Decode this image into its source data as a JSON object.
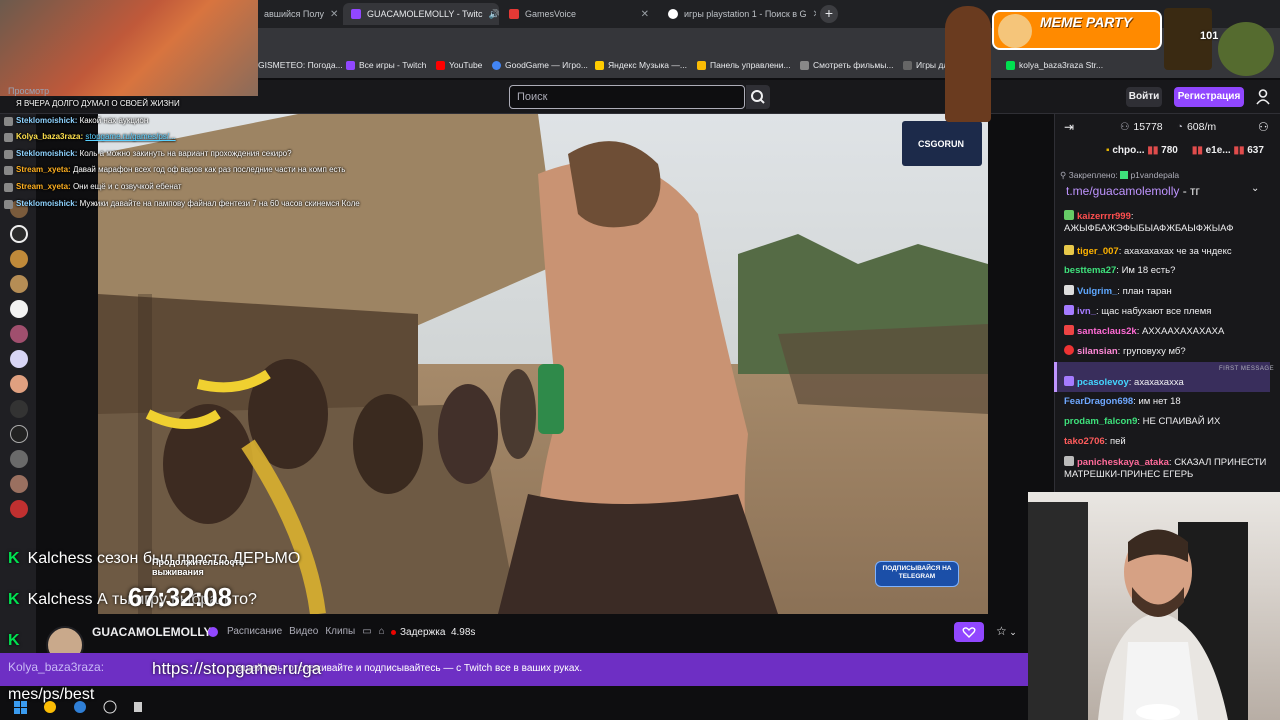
{
  "browser": {
    "tabs": [
      {
        "label": "авшийся Полу",
        "color": "#5f6368"
      },
      {
        "label": "GUACAMOLEMOLLY - Twitc",
        "color": "#9147ff"
      },
      {
        "label": "GamesVoice",
        "color": "#e53935"
      },
      {
        "label": "игры playstation 1 - Поиск в G",
        "color": "#ffffff"
      }
    ],
    "bookmarks": [
      {
        "label": "GISMETEO: Погода...",
        "color": "#4a90d9"
      },
      {
        "label": "Все игры - Twitch",
        "color": "#9147ff"
      },
      {
        "label": "YouTube",
        "color": "#ff0000"
      },
      {
        "label": "GoodGame — Игро...",
        "color": "#4285f4"
      },
      {
        "label": "Яндекс Музыка —...",
        "color": "#ffcc00"
      },
      {
        "label": "Панель управлени...",
        "color": "#fbbc05"
      },
      {
        "label": "Смотреть фильмы...",
        "color": "#888888"
      },
      {
        "label": "Игры для",
        "color": "#666666"
      },
      {
        "label": "kolya_baza3raza Str...",
        "color": "#00e050"
      }
    ]
  },
  "twitch": {
    "search_placeholder": "Поиск",
    "login": "Войти",
    "signup": "Регистрация"
  },
  "chat_overlay": [
    {
      "user": "",
      "text": "Я ВЧЕРА ДОЛГО ДУМАЛ О СВОЕЙ ЖИЗНИ",
      "color": "#ffffff"
    },
    {
      "user": "Steklomoishick:",
      "text": "Какой нах аукцион",
      "color": "#8fd3ff"
    },
    {
      "user": "Kolya_baza3raza:",
      "text": "",
      "color": "#ffe14d"
    },
    {
      "user": "Steklomoishick:",
      "text": "Коль а можно закинуть на вариант прохождения секиро?",
      "color": "#8fd3ff"
    },
    {
      "user": "Stream_xyeta:",
      "text": "Давай марафон всех год оф варов как раз последние части на комп есть",
      "color": "#ffb020"
    },
    {
      "user": "Stream_xyeta:",
      "text": "Они ещё и с озвучкой ебенат",
      "color": "#ffb020"
    },
    {
      "user": "Steklomoishick:",
      "text": "Мужики давайте на пампову файнал фентези 7 на 60 часов скинемся Коле",
      "color": "#8fd3ff"
    }
  ],
  "overlays": {
    "meme_party": "MEME PARTY",
    "meme_count": "101",
    "csgorun": "CSGORUN",
    "telegram": "ПОДПИСЫВАЙСЯ НА TELEGRAM",
    "timer": "67:32:08",
    "survival_label": "Продолжительность выживания",
    "kalchess_1_user": "Kalchess",
    "kalchess_1_text": "сезон был просто ДЕРЬМО",
    "kalchess_2_user": "Kalchess",
    "kalchess_2_text": "А ты игру выбрал то?",
    "url_line": "https://stopgame.ru/ga",
    "url_line2": "mes/ps/best",
    "prosmotr": "Просмотр"
  },
  "channel": {
    "name": "GUACAMOLEMOLLY",
    "tabs": [
      "Расписание",
      "Видео",
      "Клипы"
    ],
    "delay_label": "Задержка",
    "delay_value": "4.98s",
    "banner": "ращайтесь, отслеживайте и подписывайтесь — с Twitch все в ваших руках."
  },
  "chat": {
    "viewers": "15778",
    "points": "608/m",
    "leaderboard": [
      {
        "name": "chpo...",
        "value": "780"
      },
      {
        "name": "e1e...",
        "value": "637"
      }
    ],
    "pinned_label": "Закреплено:",
    "pinned_by": "p1vandepala",
    "pinned_link": "t.me/guacamolemolly",
    "pinned_suffix": " - тг",
    "first_message_label": "FIRST MESSAGE",
    "messages": [
      {
        "user": "kaizerrrr999",
        "text": "АЖЫФБАЖЭФЫБЫАФЖБАЫФЖЫАФ",
        "color": "#ff4f4f",
        "badge": "#6c6"
      },
      {
        "user": "tiger_007",
        "text": "ахахахахах че за чндекс",
        "color": "#ffb300",
        "badge": "#e7c84a"
      },
      {
        "user": "besttema27",
        "text": "Им 18 есть?",
        "color": "#3ee07b",
        "badge": ""
      },
      {
        "user": "Vulgrim_",
        "text": "план таран",
        "color": "#5fa8ff",
        "badge": "#ddd"
      },
      {
        "user": "ivn_",
        "text": "щас набухают все племя",
        "color": "#a57bff",
        "badge": "#a57bff"
      },
      {
        "user": "santaclaus2k",
        "text": "АХХААХАХАХАХА",
        "color": "#ff6bd5",
        "badge": "#e44"
      },
      {
        "user": "silansian",
        "text": "груповуху мб?",
        "color": "#ff8ad8",
        "badge": "#e33"
      },
      {
        "user": "pcasolevoy",
        "text": "ахахахахха",
        "color": "#44d6ff",
        "badge": "#a57bff"
      },
      {
        "user": "FearDragon698",
        "text": "им нет 18",
        "color": "#6fa8ff",
        "badge": ""
      },
      {
        "user": "prodam_falcon9",
        "text": "НЕ СПАИВАЙ ИХ",
        "color": "#3ee07b",
        "badge": ""
      },
      {
        "user": "tako2706",
        "text": "пей",
        "color": "#ff5c5c",
        "badge": ""
      },
      {
        "user": "panicheskaya_ataka",
        "text": "СКАЗАЛ ПРИНЕСТИ МАТРЕШКИ-ПРИНЕС ЕГЕРЬ",
        "color": "#ff6b9a",
        "badge": "#bbb"
      }
    ]
  }
}
